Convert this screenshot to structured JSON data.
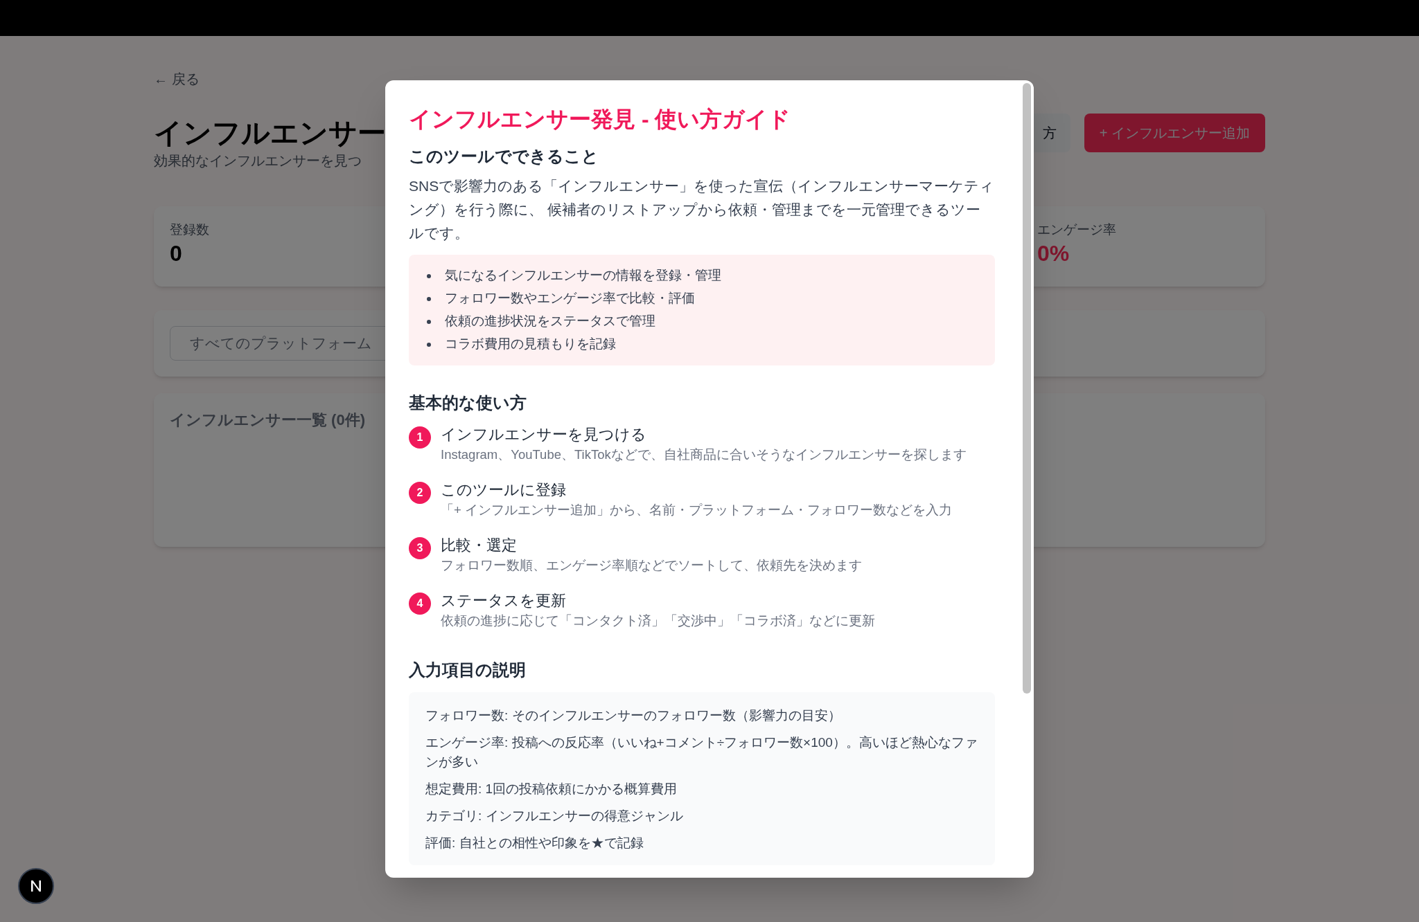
{
  "page": {
    "back_link": "← 戻る",
    "title": "インフルエンサー",
    "subtitle": "効果的なインフルエンサーを見つ",
    "guide_button": "方",
    "add_button": "+ インフルエンサー追加",
    "stats": [
      {
        "label": "登録数",
        "value": "0",
        "kind": "count"
      },
      {
        "label": "エンゲージ率",
        "value": "0%",
        "kind": "rate"
      }
    ],
    "filter": {
      "placeholder": "すべてのプラットフォーム"
    },
    "list_title": "インフルエンサー一覧 (0件)"
  },
  "modal": {
    "title": "インフルエンサー発見 - 使い方ガイド",
    "intro": {
      "heading": "このツールでできること",
      "paragraph": "SNSで影響力のある「インフルエンサー」を使った宣伝（インフルエンサーマーケティング）を行う際に、 候補者のリストアップから依頼・管理までを一元管理できるツールです。",
      "bullets": [
        "気になるインフルエンサーの情報を登録・管理",
        "フォロワー数やエンゲージ率で比較・評価",
        "依頼の進捗状況をステータスで管理",
        "コラボ費用の見積もりを記録"
      ]
    },
    "usage": {
      "heading": "基本的な使い方",
      "steps": [
        {
          "number": "1",
          "title": "インフルエンサーを見つける",
          "description": "Instagram、YouTube、TikTokなどで、自社商品に合いそうなインフルエンサーを探します"
        },
        {
          "number": "2",
          "title": "このツールに登録",
          "description": "「+ インフルエンサー追加」から、名前・プラットフォーム・フォロワー数などを入力"
        },
        {
          "number": "3",
          "title": "比較・選定",
          "description": "フォロワー数順、エンゲージ率順などでソートして、依頼先を決めます"
        },
        {
          "number": "4",
          "title": "ステータスを更新",
          "description": "依頼の進捗に応じて「コンタクト済」「交渉中」「コラボ済」などに更新"
        }
      ]
    },
    "fields": {
      "heading": "入力項目の説明",
      "items": [
        "フォロワー数: そのインフルエンサーのフォロワー数（影響力の目安）",
        "エンゲージ率: 投稿への反応率（いいね+コメント÷フォロワー数×100）。高いほど熱心なファンが多い",
        "想定費用: 1回の投稿依頼にかかる概算費用",
        "カテゴリ: インフルエンサーの得意ジャンル",
        "評価: 自社との相性や印象を★で記録"
      ]
    }
  }
}
